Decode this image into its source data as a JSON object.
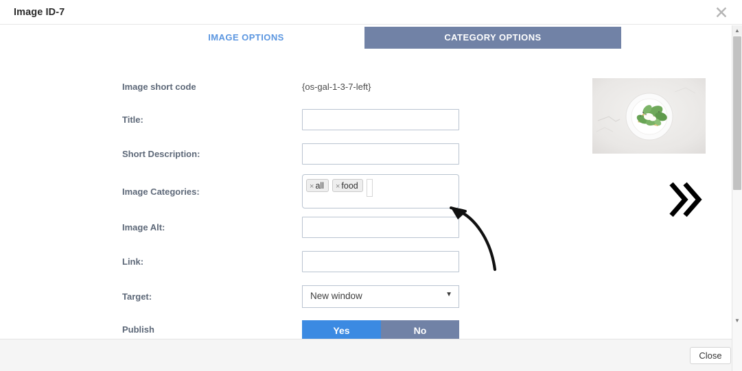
{
  "window": {
    "title": "Image ID-7",
    "close_icon": "close-icon"
  },
  "tabs": [
    {
      "label": "IMAGE OPTIONS",
      "active": false
    },
    {
      "label": "CATEGORY OPTIONS",
      "active": true
    }
  ],
  "form": {
    "short_code": {
      "label": "Image short code",
      "value": "{os-gal-1-3-7-left}"
    },
    "title": {
      "label": "Title:",
      "value": "",
      "placeholder": ""
    },
    "short_description": {
      "label": "Short Description:",
      "value": "",
      "placeholder": ""
    },
    "image_categories": {
      "label": "Image Categories:",
      "tags": [
        {
          "remove_icon": "×",
          "name": "all"
        },
        {
          "remove_icon": "×",
          "name": "food"
        }
      ],
      "input_value": "",
      "placeholder": ""
    },
    "image_alt": {
      "label": "Image Alt:",
      "value": "",
      "placeholder": ""
    },
    "link": {
      "label": "Link:",
      "value": "",
      "placeholder": ""
    },
    "target": {
      "label": "Target:",
      "selected": "New window",
      "caret": "▼"
    },
    "publish": {
      "label": "Publish",
      "yes_label": "Yes",
      "no_label": "No",
      "selected": "Yes"
    }
  },
  "thumbnail": {
    "name": "image-preview-thumbnail",
    "description": "Plated green salad toast on light marble background"
  },
  "annotations": {
    "chevron": "»",
    "curved_arrow": "curved-arrow-pointing-to-image-categories"
  },
  "scrollbar": {
    "up_arrow": "▲",
    "down_arrow": "▼"
  },
  "footer": {
    "close_label": "Close"
  },
  "colors": {
    "tab_active_bg": "#7182a6",
    "tab_inactive_text": "#5b96e0",
    "publish_yes_bg": "#3b8ae2",
    "publish_no_bg": "#7182a6",
    "label_text": "#5d6878",
    "input_border": "#b9c3d0",
    "footer_bg": "#f5f5f5"
  }
}
